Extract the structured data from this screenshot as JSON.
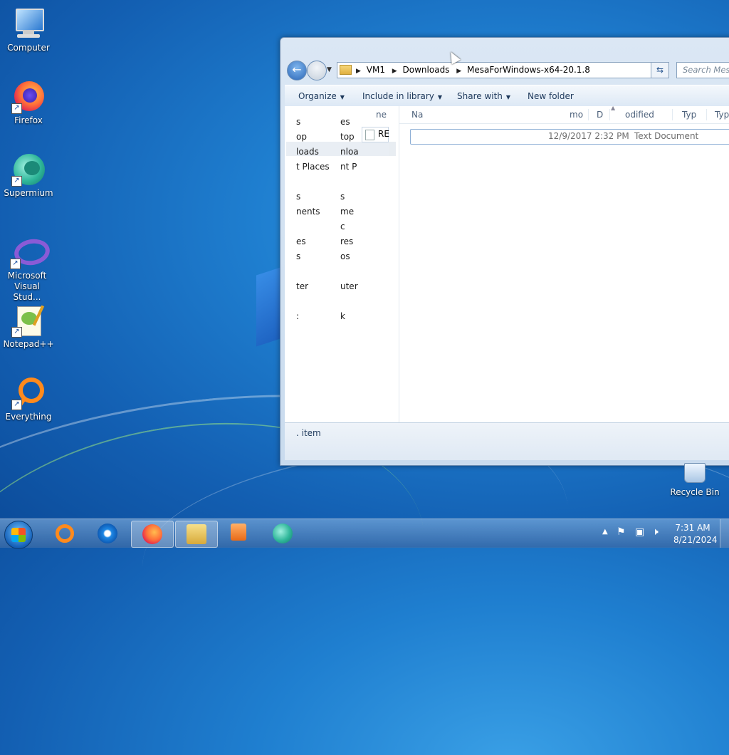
{
  "desktop": {
    "icons": [
      {
        "label": "Computer"
      },
      {
        "label": "Firefox"
      },
      {
        "label": "Supermium"
      },
      {
        "label": "Microsoft Visual Stud..."
      },
      {
        "label": "Notepad++"
      },
      {
        "label": "Everything"
      }
    ],
    "recycle_bin": "Recycle Bin"
  },
  "explorer": {
    "breadcrumbs": [
      "VM1",
      "Downloads",
      "MesaForWindows-x64-20.1.8"
    ],
    "search_placeholder": "Search MesaFor",
    "toolbar": {
      "organize": "Organize",
      "include_in_library": "Include in library",
      "share_with": "Share with",
      "new_folder": "New folder"
    },
    "nav_col1": [
      "s",
      "op",
      "loads",
      "t Places",
      "",
      "s",
      "nents",
      "",
      "es",
      "s",
      "",
      "ter",
      "",
      ":"
    ],
    "nav_col2": [
      "es",
      "top",
      "nloa",
      "nt P",
      "",
      "s",
      "me",
      "c",
      "res",
      "os",
      "",
      "uter",
      "",
      "k"
    ],
    "mini_header": "ne",
    "mini_file": "RE",
    "columns": [
      "Na",
      "mo",
      "D",
      "odified",
      "Typ",
      "Typ"
    ],
    "files": [
      {
        "date": "12/9/2017 2:32 PM",
        "type": "Text Document"
      }
    ],
    "status": ". item"
  },
  "taskbar": {
    "time": "7:31 AM",
    "date": "8/21/2024"
  }
}
